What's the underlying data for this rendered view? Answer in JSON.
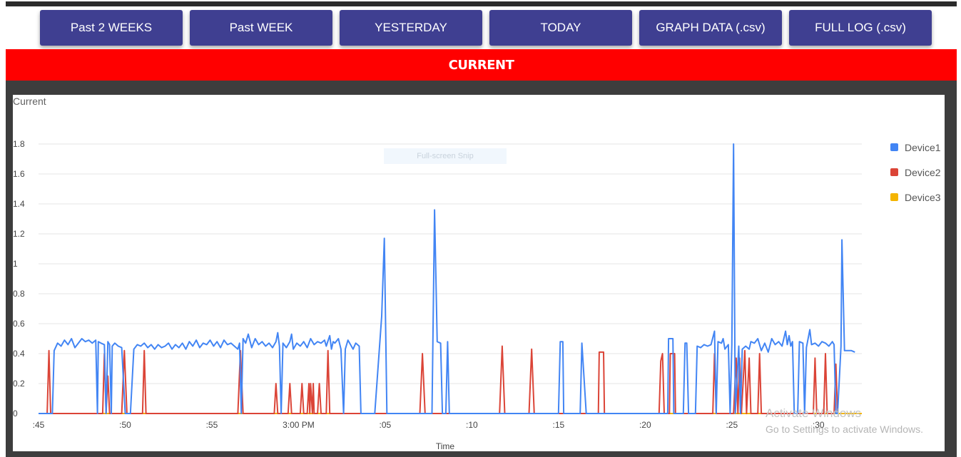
{
  "toolbar": {
    "buttons": [
      {
        "label": "Past 2 WEEKS"
      },
      {
        "label": "Past WEEK"
      },
      {
        "label": "YESTERDAY"
      },
      {
        "label": "TODAY"
      },
      {
        "label": "GRAPH DATA (.csv)"
      },
      {
        "label": "FULL LOG (.csv)"
      }
    ]
  },
  "banner": {
    "title": "CURRENT",
    "color": "#ff0000"
  },
  "overlay": {
    "snip_label": "Full-screen Snip",
    "activate_title": "Activate Windows",
    "activate_subtitle": "Go to Settings to activate Windows."
  },
  "chart_data": {
    "type": "line",
    "title": "Current",
    "xlabel": "Time",
    "ylabel": "",
    "ylim": [
      0,
      1.9
    ],
    "yticks": [
      "0",
      "0.2",
      "0.4",
      "0.6",
      "0.8",
      "1",
      "1.2",
      "1.4",
      "1.6",
      "1.8"
    ],
    "x_axis": {
      "start_time": "2:45 PM",
      "start_min": 0,
      "end_min": 47.5,
      "ticks": [
        {
          "label": ":45",
          "min": 0
        },
        {
          "label": ":50",
          "min": 5
        },
        {
          "label": ":55",
          "min": 10
        },
        {
          "label": "3:00 PM",
          "min": 15
        },
        {
          "label": ":05",
          "min": 20
        },
        {
          "label": ":10",
          "min": 25
        },
        {
          "label": ":15",
          "min": 30
        },
        {
          "label": ":20",
          "min": 35
        },
        {
          "label": ":25",
          "min": 40
        },
        {
          "label": ":30",
          "min": 45
        }
      ]
    },
    "legend_position": "right",
    "grid": true,
    "series": [
      {
        "name": "Device1",
        "color": "#4285f4",
        "points": [
          [
            0,
            0
          ],
          [
            0.8,
            0
          ],
          [
            0.9,
            0.42
          ],
          [
            1.1,
            0.47
          ],
          [
            1.3,
            0.45
          ],
          [
            1.5,
            0.49
          ],
          [
            1.7,
            0.46
          ],
          [
            1.9,
            0.5
          ],
          [
            2.1,
            0.44
          ],
          [
            2.3,
            0.47
          ],
          [
            2.5,
            0.5
          ],
          [
            2.7,
            0.48
          ],
          [
            2.9,
            0.49
          ],
          [
            3.1,
            0.47
          ],
          [
            3.3,
            0.49
          ],
          [
            3.4,
            0
          ],
          [
            3.45,
            0.48
          ],
          [
            3.6,
            0.47
          ],
          [
            3.8,
            0.46
          ],
          [
            3.9,
            0
          ],
          [
            4.0,
            0.48
          ],
          [
            4.1,
            0.46
          ],
          [
            4.2,
            0
          ],
          [
            4.25,
            0.45
          ],
          [
            4.4,
            0.47
          ],
          [
            4.6,
            0.45
          ],
          [
            4.8,
            0.44
          ],
          [
            5.0,
            0
          ],
          [
            5.3,
            0
          ],
          [
            5.5,
            0.43
          ],
          [
            5.7,
            0.46
          ],
          [
            5.9,
            0.45
          ],
          [
            6.1,
            0.47
          ],
          [
            6.3,
            0.44
          ],
          [
            6.5,
            0.46
          ],
          [
            6.7,
            0.43
          ],
          [
            6.9,
            0.46
          ],
          [
            7.1,
            0.44
          ],
          [
            7.3,
            0.45
          ],
          [
            7.5,
            0.47
          ],
          [
            7.7,
            0.43
          ],
          [
            7.9,
            0.46
          ],
          [
            8.1,
            0.44
          ],
          [
            8.3,
            0.47
          ],
          [
            8.5,
            0.43
          ],
          [
            8.7,
            0.48
          ],
          [
            8.9,
            0.45
          ],
          [
            9.1,
            0.49
          ],
          [
            9.3,
            0.44
          ],
          [
            9.5,
            0.47
          ],
          [
            9.7,
            0.46
          ],
          [
            9.9,
            0.49
          ],
          [
            10.1,
            0.45
          ],
          [
            10.3,
            0.48
          ],
          [
            10.5,
            0.44
          ],
          [
            10.7,
            0.49
          ],
          [
            10.9,
            0.46
          ],
          [
            11.1,
            0.47
          ],
          [
            11.3,
            0.45
          ],
          [
            11.5,
            0.43
          ],
          [
            11.6,
            0.47
          ],
          [
            11.7,
            0
          ],
          [
            11.8,
            0.5
          ],
          [
            11.95,
            0.47
          ],
          [
            12.1,
            0.53
          ],
          [
            12.3,
            0.44
          ],
          [
            12.5,
            0.5
          ],
          [
            12.7,
            0.46
          ],
          [
            12.9,
            0.48
          ],
          [
            13.1,
            0.45
          ],
          [
            13.3,
            0.47
          ],
          [
            13.5,
            0.44
          ],
          [
            13.7,
            0.48
          ],
          [
            13.8,
            0.54
          ],
          [
            13.9,
            0.45
          ],
          [
            14.0,
            0
          ],
          [
            14.1,
            0.47
          ],
          [
            14.3,
            0.44
          ],
          [
            14.5,
            0.48
          ],
          [
            14.6,
            0.53
          ],
          [
            14.7,
            0.43
          ],
          [
            14.9,
            0.47
          ],
          [
            15.1,
            0.45
          ],
          [
            15.3,
            0.48
          ],
          [
            15.5,
            0.44
          ],
          [
            15.7,
            0.5
          ],
          [
            15.9,
            0.46
          ],
          [
            16.1,
            0.48
          ],
          [
            16.3,
            0.47
          ],
          [
            16.5,
            0.49
          ],
          [
            16.6,
            0.45
          ],
          [
            16.8,
            0.52
          ],
          [
            16.9,
            0.43
          ],
          [
            17.0,
            0.48
          ],
          [
            17.1,
            0.47
          ],
          [
            17.3,
            0.5
          ],
          [
            17.45,
            0.43
          ],
          [
            17.6,
            0
          ],
          [
            17.7,
            0.43
          ],
          [
            17.85,
            0.49
          ],
          [
            18.0,
            0.46
          ],
          [
            18.15,
            0.43
          ],
          [
            18.3,
            0.47
          ],
          [
            18.5,
            0.45
          ],
          [
            18.6,
            0
          ],
          [
            19.4,
            0
          ],
          [
            19.8,
            0.65
          ],
          [
            19.95,
            1.17
          ],
          [
            20.1,
            0
          ],
          [
            22.7,
            0
          ],
          [
            22.85,
            1.36
          ],
          [
            23.0,
            0.48
          ],
          [
            23.2,
            0.47
          ],
          [
            23.3,
            0
          ],
          [
            23.5,
            0
          ],
          [
            23.6,
            0.48
          ],
          [
            23.7,
            0
          ],
          [
            30.0,
            0
          ],
          [
            30.1,
            0.48
          ],
          [
            30.25,
            0.48
          ],
          [
            30.3,
            0
          ],
          [
            31.25,
            0
          ],
          [
            31.35,
            0.47
          ],
          [
            31.6,
            0
          ],
          [
            36.3,
            0
          ],
          [
            36.35,
            0.5
          ],
          [
            36.6,
            0.5
          ],
          [
            36.65,
            0
          ],
          [
            37.2,
            0
          ],
          [
            37.3,
            0.47
          ],
          [
            37.4,
            0.47
          ],
          [
            37.5,
            0
          ],
          [
            37.9,
            0
          ],
          [
            38.0,
            0.45
          ],
          [
            38.2,
            0.44
          ],
          [
            38.4,
            0.46
          ],
          [
            38.6,
            0.45
          ],
          [
            38.8,
            0.46
          ],
          [
            39.0,
            0.55
          ],
          [
            39.1,
            0
          ],
          [
            39.2,
            0.48
          ],
          [
            39.4,
            0.47
          ],
          [
            39.5,
            0.5
          ],
          [
            39.6,
            0.43
          ],
          [
            39.8,
            0.46
          ],
          [
            39.9,
            0
          ],
          [
            40.0,
            0.46
          ],
          [
            40.1,
            1.8
          ],
          [
            40.2,
            0
          ],
          [
            40.4,
            0.45
          ],
          [
            40.5,
            0
          ],
          [
            40.6,
            0.43
          ],
          [
            40.8,
            0.45
          ],
          [
            41.0,
            0.43
          ],
          [
            41.1,
            0.48
          ],
          [
            41.3,
            0.47
          ],
          [
            41.5,
            0.5
          ],
          [
            41.7,
            0.42
          ],
          [
            41.9,
            0.47
          ],
          [
            42.1,
            0.41
          ],
          [
            42.3,
            0.5
          ],
          [
            42.5,
            0.46
          ],
          [
            42.7,
            0.48
          ],
          [
            42.9,
            0.45
          ],
          [
            43.1,
            0.55
          ],
          [
            43.2,
            0.46
          ],
          [
            43.3,
            0.52
          ],
          [
            43.4,
            0.45
          ],
          [
            43.5,
            0.48
          ],
          [
            43.6,
            0
          ],
          [
            43.8,
            0
          ],
          [
            43.9,
            0.48
          ],
          [
            44.1,
            0.47
          ],
          [
            44.2,
            0
          ],
          [
            44.3,
            0.44
          ],
          [
            44.5,
            0.56
          ],
          [
            44.6,
            0.46
          ],
          [
            44.8,
            0.47
          ],
          [
            45.0,
            0.45
          ],
          [
            45.2,
            0.48
          ],
          [
            45.4,
            0.47
          ],
          [
            45.6,
            0.45
          ],
          [
            45.8,
            0.48
          ],
          [
            45.9,
            0.46
          ],
          [
            46.0,
            0
          ],
          [
            46.1,
            0
          ],
          [
            46.3,
            0.45
          ],
          [
            46.35,
            1.16
          ],
          [
            46.5,
            0.42
          ],
          [
            46.7,
            0.42
          ],
          [
            46.9,
            0.42
          ],
          [
            47.1,
            0.41
          ]
        ]
      },
      {
        "name": "Device2",
        "color": "#db4437",
        "points": [
          [
            0,
            0
          ],
          [
            0.5,
            0
          ],
          [
            0.6,
            0.42
          ],
          [
            0.7,
            0
          ],
          [
            3.7,
            0
          ],
          [
            3.8,
            0.4
          ],
          [
            3.9,
            0
          ],
          [
            4.0,
            0.25
          ],
          [
            4.1,
            0
          ],
          [
            4.8,
            0
          ],
          [
            4.95,
            0.42
          ],
          [
            5.1,
            0
          ],
          [
            6.0,
            0
          ],
          [
            6.1,
            0.42
          ],
          [
            6.2,
            0
          ],
          [
            11.5,
            0
          ],
          [
            11.65,
            0.42
          ],
          [
            11.8,
            0
          ],
          [
            13.6,
            0
          ],
          [
            13.7,
            0.2
          ],
          [
            13.8,
            0
          ],
          [
            14.4,
            0
          ],
          [
            14.5,
            0.2
          ],
          [
            14.6,
            0
          ],
          [
            15.1,
            0
          ],
          [
            15.2,
            0.2
          ],
          [
            15.3,
            0
          ],
          [
            15.5,
            0
          ],
          [
            15.6,
            0.2
          ],
          [
            15.65,
            0
          ],
          [
            15.7,
            0.2
          ],
          [
            15.8,
            0
          ],
          [
            15.85,
            0.2
          ],
          [
            15.9,
            0
          ],
          [
            16.1,
            0
          ],
          [
            16.2,
            0.2
          ],
          [
            16.3,
            0
          ],
          [
            16.6,
            0
          ],
          [
            16.7,
            0.42
          ],
          [
            16.8,
            0
          ],
          [
            22.0,
            0
          ],
          [
            22.15,
            0.4
          ],
          [
            22.3,
            0
          ],
          [
            26.6,
            0
          ],
          [
            26.75,
            0.45
          ],
          [
            26.9,
            0
          ],
          [
            28.3,
            0
          ],
          [
            28.45,
            0.43
          ],
          [
            28.6,
            0
          ],
          [
            32.3,
            0
          ],
          [
            32.35,
            0.41
          ],
          [
            32.6,
            0.41
          ],
          [
            32.65,
            0
          ],
          [
            35.8,
            0
          ],
          [
            35.9,
            0.35
          ],
          [
            36.0,
            0.4
          ],
          [
            36.1,
            0
          ],
          [
            36.4,
            0
          ],
          [
            36.45,
            0.4
          ],
          [
            36.7,
            0.4
          ],
          [
            36.75,
            0
          ],
          [
            38.9,
            0
          ],
          [
            39.0,
            0.4
          ],
          [
            39.1,
            0
          ],
          [
            40.1,
            0
          ],
          [
            40.25,
            0.37
          ],
          [
            40.35,
            0
          ],
          [
            40.45,
            0.37
          ],
          [
            40.55,
            0
          ],
          [
            40.75,
            0.42
          ],
          [
            40.85,
            0
          ],
          [
            41.0,
            0.37
          ],
          [
            41.1,
            0
          ],
          [
            41.5,
            0
          ],
          [
            41.6,
            0.4
          ],
          [
            41.7,
            0
          ],
          [
            44.7,
            0
          ],
          [
            44.8,
            0.37
          ],
          [
            44.9,
            0
          ],
          [
            45.3,
            0
          ],
          [
            45.4,
            0.4
          ],
          [
            45.5,
            0
          ],
          [
            45.9,
            0
          ],
          [
            46.0,
            0.33
          ],
          [
            46.1,
            0
          ]
        ]
      },
      {
        "name": "Device3",
        "color": "#f4b400",
        "points": [
          [
            0,
            0
          ],
          [
            47.5,
            0
          ]
        ]
      }
    ]
  }
}
